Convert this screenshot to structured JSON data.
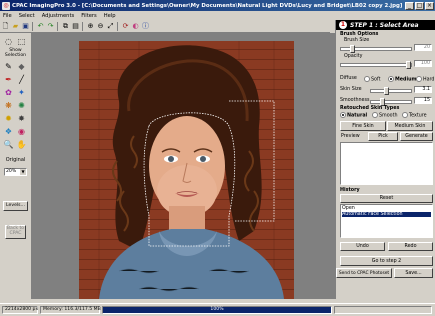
{
  "window": {
    "title": "CPAC ImagingPro 3.0 - [C:\\Documents and Settings\\Owner\\My Documents\\Natural Light DVDs\\Lucy and Bridget\\LB02 copy 2.jpg]",
    "minimize": "_",
    "maximize": "□",
    "close": "×"
  },
  "menu": [
    "File",
    "Select",
    "Adjustments",
    "Filters",
    "Help"
  ],
  "toolbar": {
    "icons": [
      "new-icon",
      "open-icon",
      "save-icon",
      "undo-icon",
      "redo-icon",
      "copy-icon",
      "paste-icon",
      "zoom-in-icon",
      "zoom-out-icon",
      "fit-icon",
      "rotate-icon",
      "color-icon",
      "info-icon"
    ]
  },
  "tools": {
    "show_selection_label": "Show\nSelection",
    "original_label": "Original",
    "zoom_value": "20%",
    "levels_label": "Levels...",
    "back_to_cpac": "Back to\nCPAC"
  },
  "step": {
    "number": "1",
    "title": "STEP 1 : Select Area"
  },
  "brush": {
    "heading": "Brush Options",
    "size_label": "Brush Size",
    "size_value": "20",
    "opacity_label": "Opacity",
    "opacity_value": "100"
  },
  "diffuse": {
    "label": "Diffuse",
    "options": [
      "Soft",
      "Medium",
      "Hard"
    ],
    "selected": "Medium"
  },
  "skin": {
    "size_label": "Skin Size",
    "size_value": "3.1",
    "smoothness_label": "Smoothness",
    "smoothness_value": "15",
    "retouched_heading": "Retouched Skin Types",
    "types": [
      "Natural",
      "Smooth",
      "Texture"
    ],
    "selected_type": "Natural",
    "fine_skin": "Fine Skin",
    "medium_skin": "Medium Skin"
  },
  "preview": {
    "label": "Preview",
    "pick": "Pick",
    "generate": "Generate"
  },
  "history": {
    "label": "History",
    "reset": "Reset",
    "items": [
      "Open",
      "Automatic Face Selection"
    ],
    "selected_index": 1,
    "undo": "Undo",
    "redo": "Redo"
  },
  "actions": {
    "go_to_step": "Go to step 2",
    "send": "Send to CPAC Photoset",
    "save": "Save..."
  },
  "status": {
    "dimensions": "2214x2800 px",
    "memory": "Memory: 116.3/117.5 MB",
    "progress_text": "100%",
    "progress": 1.0
  },
  "colors": {
    "titlebar": "#0a246a",
    "selection": "#0a246a",
    "step_header_bg": "#000000"
  }
}
